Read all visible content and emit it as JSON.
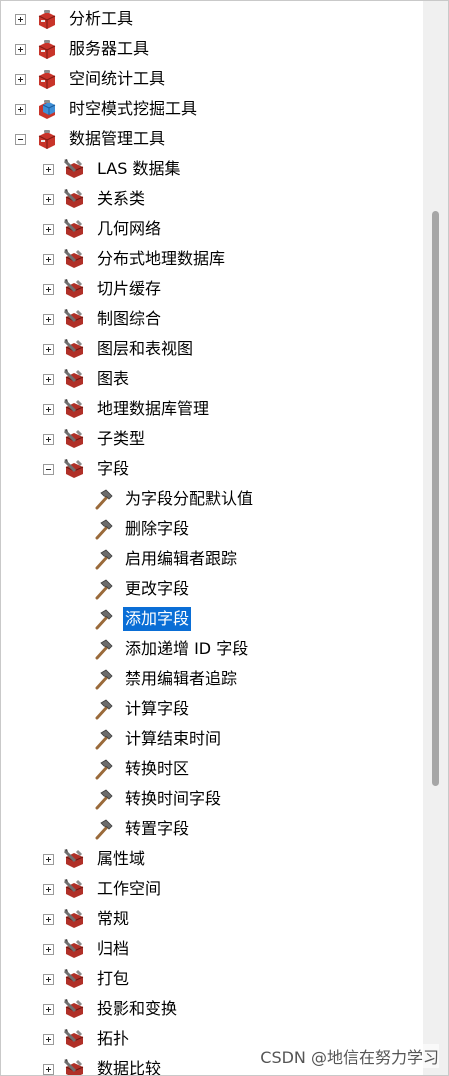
{
  "tree": [
    {
      "level": 0,
      "state": "plus",
      "icon": "toolbox-red-icon",
      "label": "分析工具"
    },
    {
      "level": 0,
      "state": "plus",
      "icon": "toolbox-red-icon",
      "label": "服务器工具"
    },
    {
      "level": 0,
      "state": "plus",
      "icon": "toolbox-red-icon",
      "label": "空间统计工具"
    },
    {
      "level": 0,
      "state": "plus",
      "icon": "toolbox-cube-icon",
      "label": "时空模式挖掘工具"
    },
    {
      "level": 0,
      "state": "minus",
      "icon": "toolbox-red-icon",
      "label": "数据管理工具"
    },
    {
      "level": 1,
      "state": "plus",
      "icon": "toolset-icon",
      "label": "LAS 数据集"
    },
    {
      "level": 1,
      "state": "plus",
      "icon": "toolset-icon",
      "label": "关系类"
    },
    {
      "level": 1,
      "state": "plus",
      "icon": "toolset-icon",
      "label": "几何网络"
    },
    {
      "level": 1,
      "state": "plus",
      "icon": "toolset-icon",
      "label": "分布式地理数据库"
    },
    {
      "level": 1,
      "state": "plus",
      "icon": "toolset-icon",
      "label": "切片缓存"
    },
    {
      "level": 1,
      "state": "plus",
      "icon": "toolset-icon",
      "label": "制图综合"
    },
    {
      "level": 1,
      "state": "plus",
      "icon": "toolset-icon",
      "label": "图层和表视图"
    },
    {
      "level": 1,
      "state": "plus",
      "icon": "toolset-icon",
      "label": "图表"
    },
    {
      "level": 1,
      "state": "plus",
      "icon": "toolset-icon",
      "label": "地理数据库管理"
    },
    {
      "level": 1,
      "state": "plus",
      "icon": "toolset-icon",
      "label": "子类型"
    },
    {
      "level": 1,
      "state": "minus",
      "icon": "toolset-icon",
      "label": "字段"
    },
    {
      "level": 2,
      "state": "none",
      "icon": "hammer-icon",
      "label": "为字段分配默认值"
    },
    {
      "level": 2,
      "state": "none",
      "icon": "hammer-icon",
      "label": "删除字段"
    },
    {
      "level": 2,
      "state": "none",
      "icon": "hammer-icon",
      "label": "启用编辑者跟踪"
    },
    {
      "level": 2,
      "state": "none",
      "icon": "hammer-icon",
      "label": "更改字段"
    },
    {
      "level": 2,
      "state": "none",
      "icon": "hammer-icon",
      "label": "添加字段",
      "selected": true
    },
    {
      "level": 2,
      "state": "none",
      "icon": "hammer-icon",
      "label": "添加递增 ID 字段"
    },
    {
      "level": 2,
      "state": "none",
      "icon": "hammer-icon",
      "label": "禁用编辑者追踪"
    },
    {
      "level": 2,
      "state": "none",
      "icon": "hammer-icon",
      "label": "计算字段"
    },
    {
      "level": 2,
      "state": "none",
      "icon": "hammer-icon",
      "label": "计算结束时间"
    },
    {
      "level": 2,
      "state": "none",
      "icon": "hammer-icon",
      "label": "转换时区"
    },
    {
      "level": 2,
      "state": "none",
      "icon": "hammer-icon",
      "label": "转换时间字段"
    },
    {
      "level": 2,
      "state": "none",
      "icon": "hammer-icon",
      "label": "转置字段"
    },
    {
      "level": 1,
      "state": "plus",
      "icon": "toolset-icon",
      "label": "属性域"
    },
    {
      "level": 1,
      "state": "plus",
      "icon": "toolset-icon",
      "label": "工作空间"
    },
    {
      "level": 1,
      "state": "plus",
      "icon": "toolset-icon",
      "label": "常规"
    },
    {
      "level": 1,
      "state": "plus",
      "icon": "toolset-icon",
      "label": "归档"
    },
    {
      "level": 1,
      "state": "plus",
      "icon": "toolset-icon",
      "label": "打包"
    },
    {
      "level": 1,
      "state": "plus",
      "icon": "toolset-icon",
      "label": "投影和变换"
    },
    {
      "level": 1,
      "state": "plus",
      "icon": "toolset-icon",
      "label": "拓扑"
    },
    {
      "level": 1,
      "state": "plus",
      "icon": "toolset-icon",
      "label": "数据比较"
    }
  ],
  "colors": {
    "selection": "#0a6ed6",
    "toolbox_red": "#c8342a",
    "toolset_gray": "#7a7a7a"
  },
  "watermark": "CSDN @地信在努力学习"
}
